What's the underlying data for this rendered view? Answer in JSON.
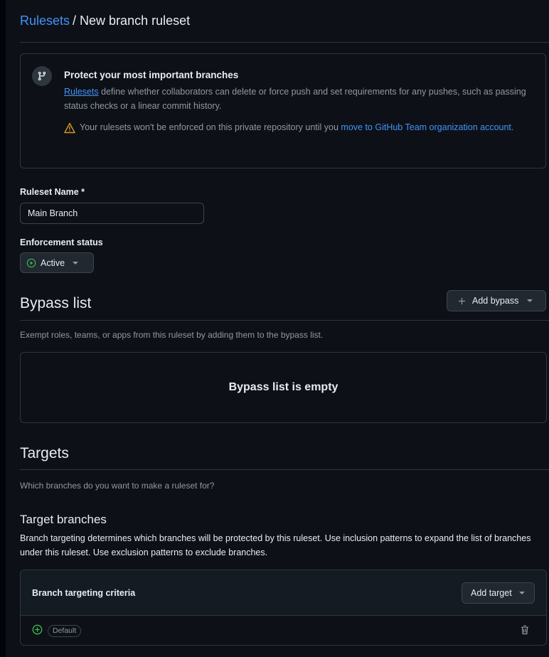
{
  "breadcrumb": {
    "parent": "Rulesets",
    "separator": "/",
    "current": "New branch ruleset"
  },
  "notice": {
    "title": "Protect your most important branches",
    "desc_link": "Rulesets",
    "desc_text": " define whether collaborators can delete or force push and set requirements for any pushes, such as passing status checks or a linear commit history.",
    "warning_text": "Your rulesets won't be enforced on this private repository until you ",
    "warning_link": "move to GitHub Team organization account."
  },
  "form": {
    "name_label": "Ruleset Name *",
    "name_value": "Main Branch",
    "enforcement_label": "Enforcement status",
    "enforcement_value": "Active"
  },
  "bypass": {
    "heading": "Bypass list",
    "add_button": "Add bypass",
    "description": "Exempt roles, teams, or apps from this ruleset by adding them to the bypass list.",
    "empty_text": "Bypass list is empty"
  },
  "targets": {
    "heading": "Targets",
    "description": "Which branches do you want to make a ruleset for?",
    "subheading": "Target branches",
    "sub_description": "Branch targeting determines which branches will be protected by this ruleset. Use inclusion patterns to expand the list of branches under this ruleset. Use exclusion patterns to exclude branches.",
    "criteria_title": "Branch targeting criteria",
    "add_target_button": "Add target",
    "default_pill": "Default"
  },
  "colors": {
    "accent": "#4493f8",
    "success": "#3fb950",
    "warning": "#d29922"
  },
  "icons": [
    "branch-icon",
    "alert-icon",
    "play-circle-icon",
    "plus-icon",
    "plus-circle-icon",
    "trash-icon"
  ]
}
